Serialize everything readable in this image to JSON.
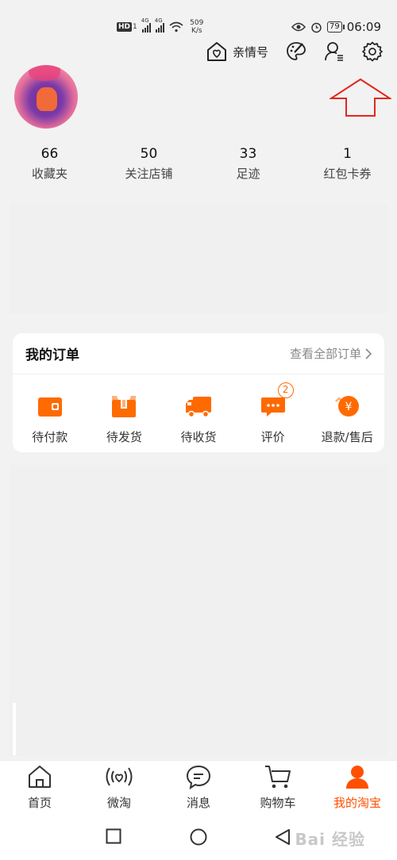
{
  "status_bar": {
    "hd": "HD",
    "hd_sub": "1",
    "net1": "4G",
    "net2": "4G",
    "speed_value": "509",
    "speed_unit": "K/s",
    "battery": "79",
    "time": "06:09"
  },
  "top_actions": {
    "family_label": "亲情号"
  },
  "stats": [
    {
      "value": "66",
      "label": "收藏夹"
    },
    {
      "value": "50",
      "label": "关注店铺"
    },
    {
      "value": "33",
      "label": "足迹"
    },
    {
      "value": "1",
      "label": "红包卡券"
    }
  ],
  "orders": {
    "title": "我的订单",
    "view_all": "查看全部订单",
    "items": [
      {
        "label": "待付款",
        "icon": "wallet-icon"
      },
      {
        "label": "待发货",
        "icon": "package-icon"
      },
      {
        "label": "待收货",
        "icon": "truck-icon"
      },
      {
        "label": "评价",
        "icon": "comment-icon",
        "badge": "2"
      },
      {
        "label": "退款/售后",
        "icon": "refund-icon"
      }
    ]
  },
  "tabs": [
    {
      "label": "首页",
      "icon": "home-icon"
    },
    {
      "label": "微淘",
      "icon": "weitao-icon"
    },
    {
      "label": "消息",
      "icon": "message-icon"
    },
    {
      "label": "购物车",
      "icon": "cart-icon"
    },
    {
      "label": "我的淘宝",
      "icon": "profile-icon",
      "active": true
    }
  ],
  "colors": {
    "accent": "#ff5000",
    "order_icon": "#ff6a00",
    "annotation_arrow": "#e0281e"
  },
  "watermark": "Bai 经验"
}
